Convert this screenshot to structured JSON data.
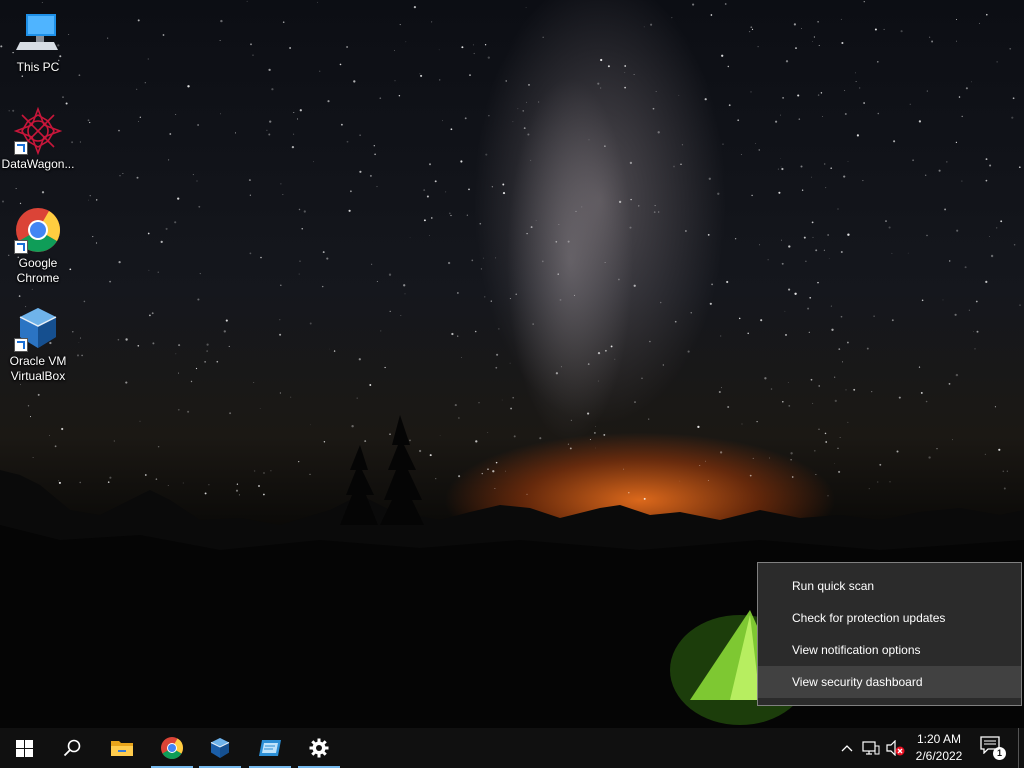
{
  "desktop": {
    "icons": [
      {
        "label": "This PC"
      },
      {
        "label": "DataWagon..."
      },
      {
        "label": "Google Chrome"
      },
      {
        "label": "Oracle VM VirtualBox"
      }
    ]
  },
  "context_menu": {
    "items": [
      {
        "label": "Run quick scan"
      },
      {
        "label": "Check for protection updates"
      },
      {
        "label": "View notification options"
      },
      {
        "label": "View security dashboard"
      }
    ],
    "highlighted": "View security dashboard"
  },
  "taskbar": {
    "pinned": [
      {
        "name": "start",
        "icon": "windows-logo-icon"
      },
      {
        "name": "search",
        "icon": "search-icon"
      },
      {
        "name": "file-explorer",
        "icon": "folder-icon"
      },
      {
        "name": "chrome",
        "icon": "chrome-icon"
      },
      {
        "name": "virtualbox",
        "icon": "virtualbox-icon"
      },
      {
        "name": "app",
        "icon": "app-window-icon"
      },
      {
        "name": "settings",
        "icon": "gear-icon"
      }
    ],
    "clock": {
      "time": "1:20 AM",
      "date": "2/6/2022"
    },
    "notification_count": "1"
  },
  "colors": {
    "taskbar": "#101010",
    "menu_bg": "#2b2b2b",
    "menu_hover": "#414141",
    "running_indicator": "#76b9ed"
  }
}
